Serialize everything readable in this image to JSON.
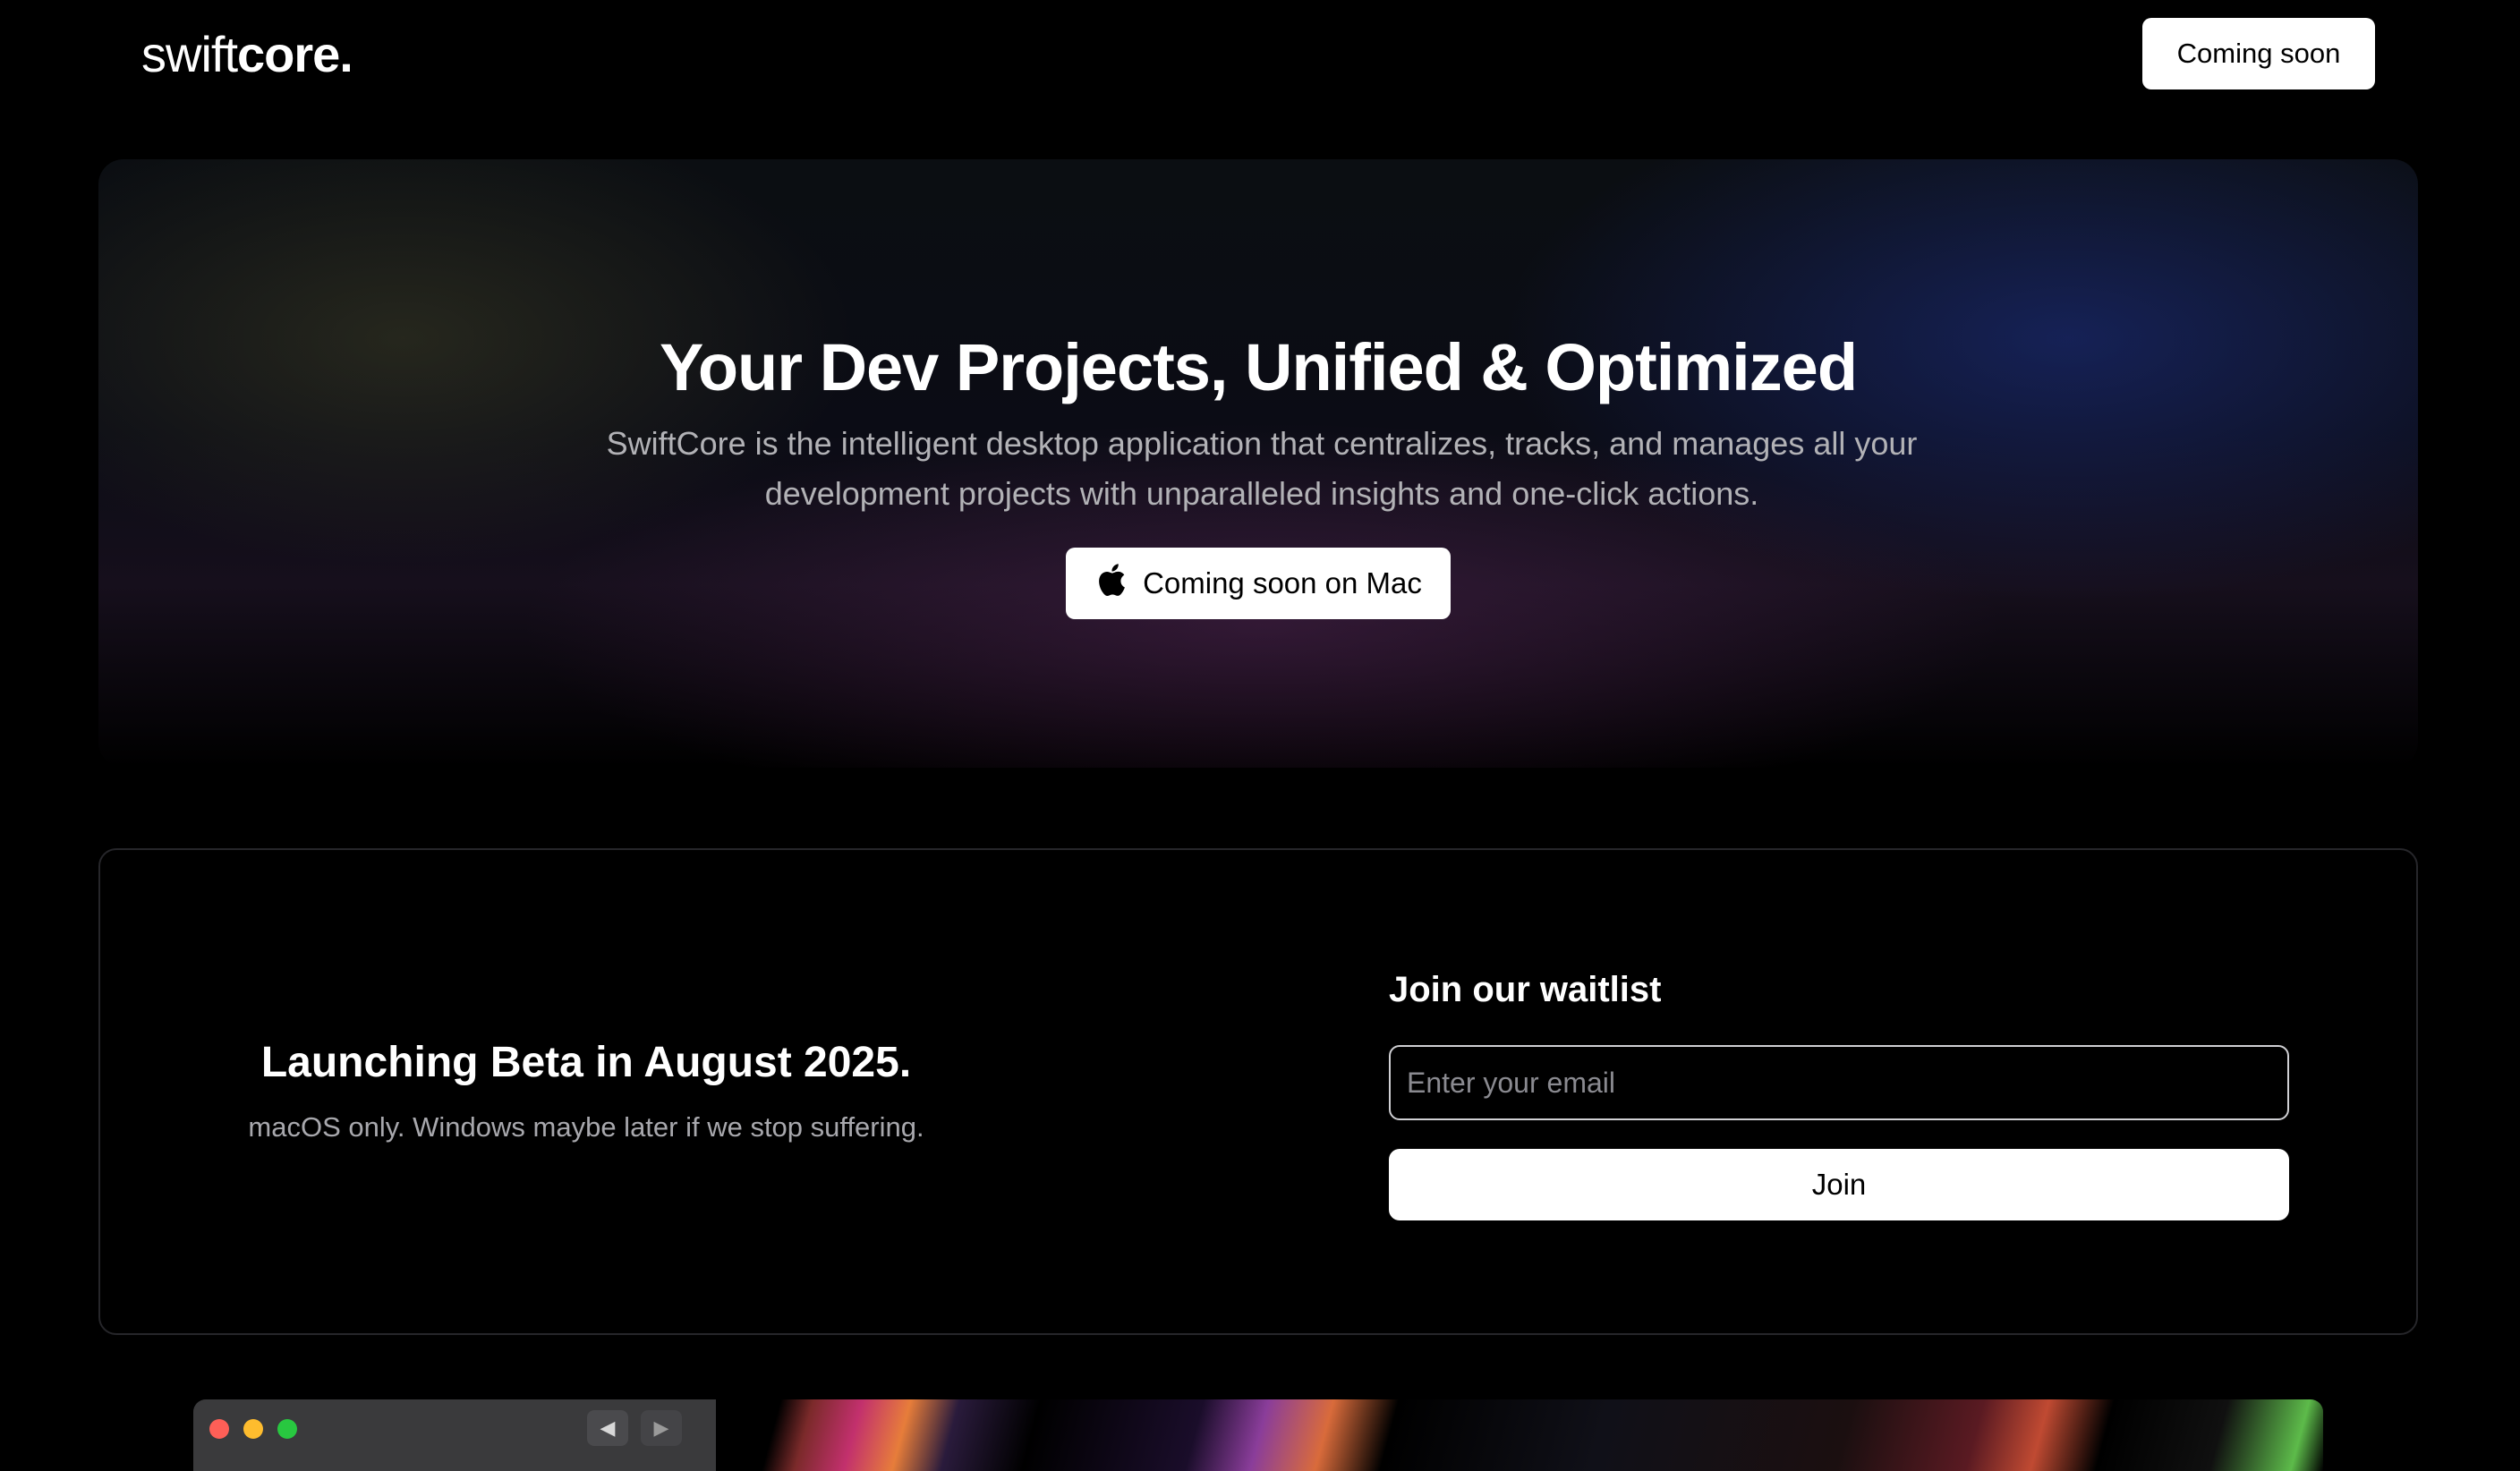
{
  "header": {
    "logo_light": "swift",
    "logo_bold": "core.",
    "cta_label": "Coming soon"
  },
  "hero": {
    "title": "Your Dev Projects, Unified & Optimized",
    "subtitle": "SwiftCore is the intelligent desktop application that centralizes, tracks, and manages all your development projects with unparalleled insights and one-click actions.",
    "cta_label": "Coming soon on Mac",
    "cta_icon": "apple-icon"
  },
  "waitlist_section": {
    "beta_title": "Launching Beta in August 2025.",
    "beta_subtitle": "macOS only. Windows maybe later if we stop suffering.",
    "form_title": "Join our waitlist",
    "email_placeholder": "Enter your email",
    "email_value": "",
    "join_label": "Join"
  },
  "preview": {
    "window_controls": [
      "close",
      "minimize",
      "maximize"
    ],
    "back_icon": "◀",
    "forward_icon": "▶"
  },
  "colors": {
    "background": "#000000",
    "button_bg": "#ffffff",
    "button_text": "#000000",
    "muted_text": "#b2b2b6"
  }
}
